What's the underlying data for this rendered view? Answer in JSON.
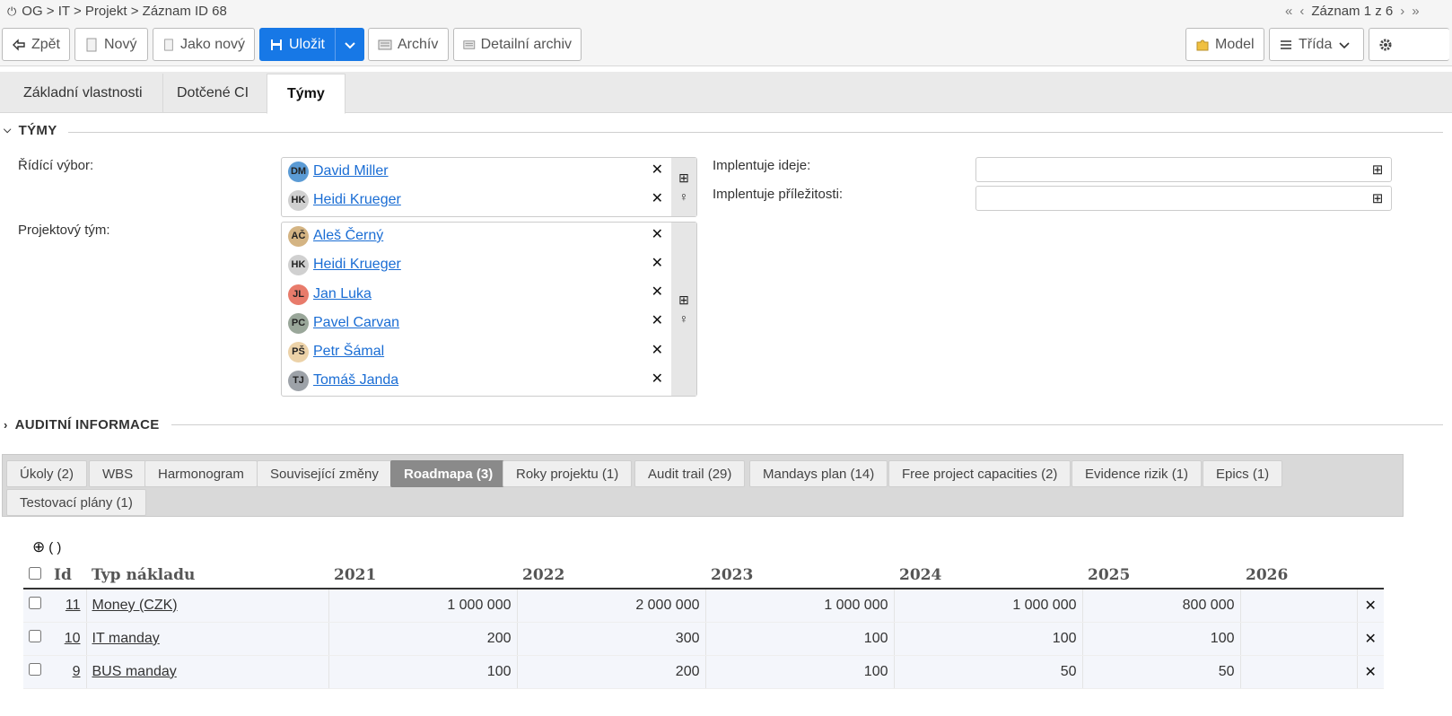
{
  "breadcrumb": {
    "path": "OG > IT > Projekt > Záznam ID 68"
  },
  "record_nav": {
    "label": "Záznam 1 z 6"
  },
  "toolbar": {
    "back": "Zpět",
    "new": "Nový",
    "copy": "Jako nový",
    "save": "Uložit",
    "archive": "Archív",
    "detail_archive": "Detailní archiv",
    "model": "Model",
    "class": "Třída"
  },
  "main_tabs": [
    {
      "label": "Základní vlastnosti"
    },
    {
      "label": "Dotčené CI"
    },
    {
      "label": "Týmy"
    }
  ],
  "section_teams": {
    "title": "TÝMY"
  },
  "steering": {
    "label": "Řídící výbor:",
    "members": [
      {
        "initials": "DM",
        "name": "David Miller",
        "color": "#5b9bd5"
      },
      {
        "initials": "HK",
        "name": "Heidi Krueger",
        "color": "#d0d0d0"
      }
    ]
  },
  "project_team": {
    "label": "Projektový tým:",
    "members": [
      {
        "initials": "AČ",
        "name": "Aleš Černý",
        "color": "#d4b483"
      },
      {
        "initials": "HK",
        "name": "Heidi Krueger",
        "color": "#d0d0d0"
      },
      {
        "initials": "JL",
        "name": "Jan Luka",
        "color": "#e87b6b"
      },
      {
        "initials": "PC",
        "name": "Pavel Carvan",
        "color": "#9aa79a"
      },
      {
        "initials": "PŠ",
        "name": "Petr Šámal",
        "color": "#ecd2a8"
      },
      {
        "initials": "TJ",
        "name": "Tomáš Janda",
        "color": "#9da2a8"
      }
    ]
  },
  "implements_ideas": {
    "label": "Implentuje ideje:",
    "value": ""
  },
  "implements_opps": {
    "label": "Implentuje příležitosti:",
    "value": ""
  },
  "section_audit": {
    "title": "AUDITNÍ INFORMACE"
  },
  "bottom_tabs": [
    {
      "label": "Úkoly (2)"
    },
    {
      "label": "WBS"
    },
    {
      "label": "Harmonogram"
    },
    {
      "label": "Související změny"
    },
    {
      "label": "Roadmapa (3)"
    },
    {
      "label": "Roky projektu (1)"
    },
    {
      "label": "Audit trail (29)"
    },
    {
      "label": "Mandays plan (14)"
    },
    {
      "label": "Free project capacities (2)"
    },
    {
      "label": "Evidence rizik (1)"
    },
    {
      "label": "Epics (1)"
    },
    {
      "label": "Testovací plány (1)"
    }
  ],
  "grid": {
    "add_label": "( )",
    "columns": [
      "Id",
      "Typ nákladu",
      "2021",
      "2022",
      "2023",
      "2024",
      "2025",
      "2026"
    ],
    "rows": [
      {
        "id": "11",
        "type": "Money (CZK)",
        "y2021": "1 000 000",
        "y2022": "2 000 000",
        "y2023": "1 000 000",
        "y2024": "1 000 000",
        "y2025": "800 000",
        "y2026": ""
      },
      {
        "id": "10",
        "type": "IT manday",
        "y2021": "200",
        "y2022": "300",
        "y2023": "100",
        "y2024": "100",
        "y2025": "100",
        "y2026": ""
      },
      {
        "id": "9",
        "type": "BUS manday",
        "y2021": "100",
        "y2022": "200",
        "y2023": "100",
        "y2024": "50",
        "y2025": "50",
        "y2026": ""
      }
    ]
  }
}
